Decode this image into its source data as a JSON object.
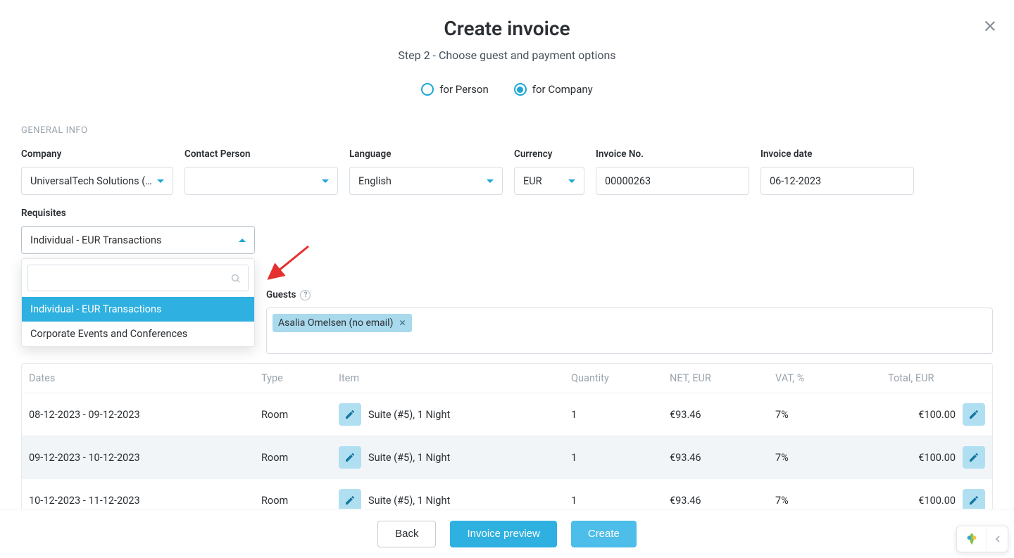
{
  "header": {
    "title": "Create invoice",
    "subtitle": "Step 2 - Choose guest and payment options"
  },
  "radios": {
    "person": "for Person",
    "company": "for Company",
    "selected": "company"
  },
  "section_general": "GENERAL INFO",
  "fields": {
    "company": {
      "label": "Company",
      "value": "UniversalTech Solutions (B…"
    },
    "contact": {
      "label": "Contact Person",
      "value": ""
    },
    "language": {
      "label": "Language",
      "value": "English"
    },
    "currency": {
      "label": "Currency",
      "value": "EUR"
    },
    "invoice_no": {
      "label": "Invoice No.",
      "value": "00000263"
    },
    "invoice_dt": {
      "label": "Invoice date",
      "value": "06-12-2023"
    },
    "requisites": {
      "label": "Requisites",
      "value": "Individual - EUR Transactions"
    }
  },
  "requisites_dropdown": {
    "search_value": "",
    "options": [
      "Individual - EUR Transactions",
      "Corporate Events and Conferences"
    ],
    "selected_index": 0
  },
  "guests": {
    "label": "Guests",
    "chip": "Asalia Omelsen (no email)"
  },
  "table": {
    "headers": {
      "dates": "Dates",
      "type": "Type",
      "item": "Item",
      "qty": "Quantity",
      "net": "NET, EUR",
      "vat": "VAT, %",
      "total": "Total, EUR"
    },
    "rows": [
      {
        "dates": "08-12-2023 - 09-12-2023",
        "type": "Room",
        "item": "Suite (#5), 1 Night",
        "qty": "1",
        "net": "€93.46",
        "vat": "7%",
        "total": "€100.00"
      },
      {
        "dates": "09-12-2023 - 10-12-2023",
        "type": "Room",
        "item": "Suite (#5), 1 Night",
        "qty": "1",
        "net": "€93.46",
        "vat": "7%",
        "total": "€100.00"
      },
      {
        "dates": "10-12-2023 - 11-12-2023",
        "type": "Room",
        "item": "Suite (#5), 1 Night",
        "qty": "1",
        "net": "€93.46",
        "vat": "7%",
        "total": "€100.00"
      }
    ]
  },
  "footer": {
    "back": "Back",
    "preview": "Invoice preview",
    "create": "Create"
  }
}
